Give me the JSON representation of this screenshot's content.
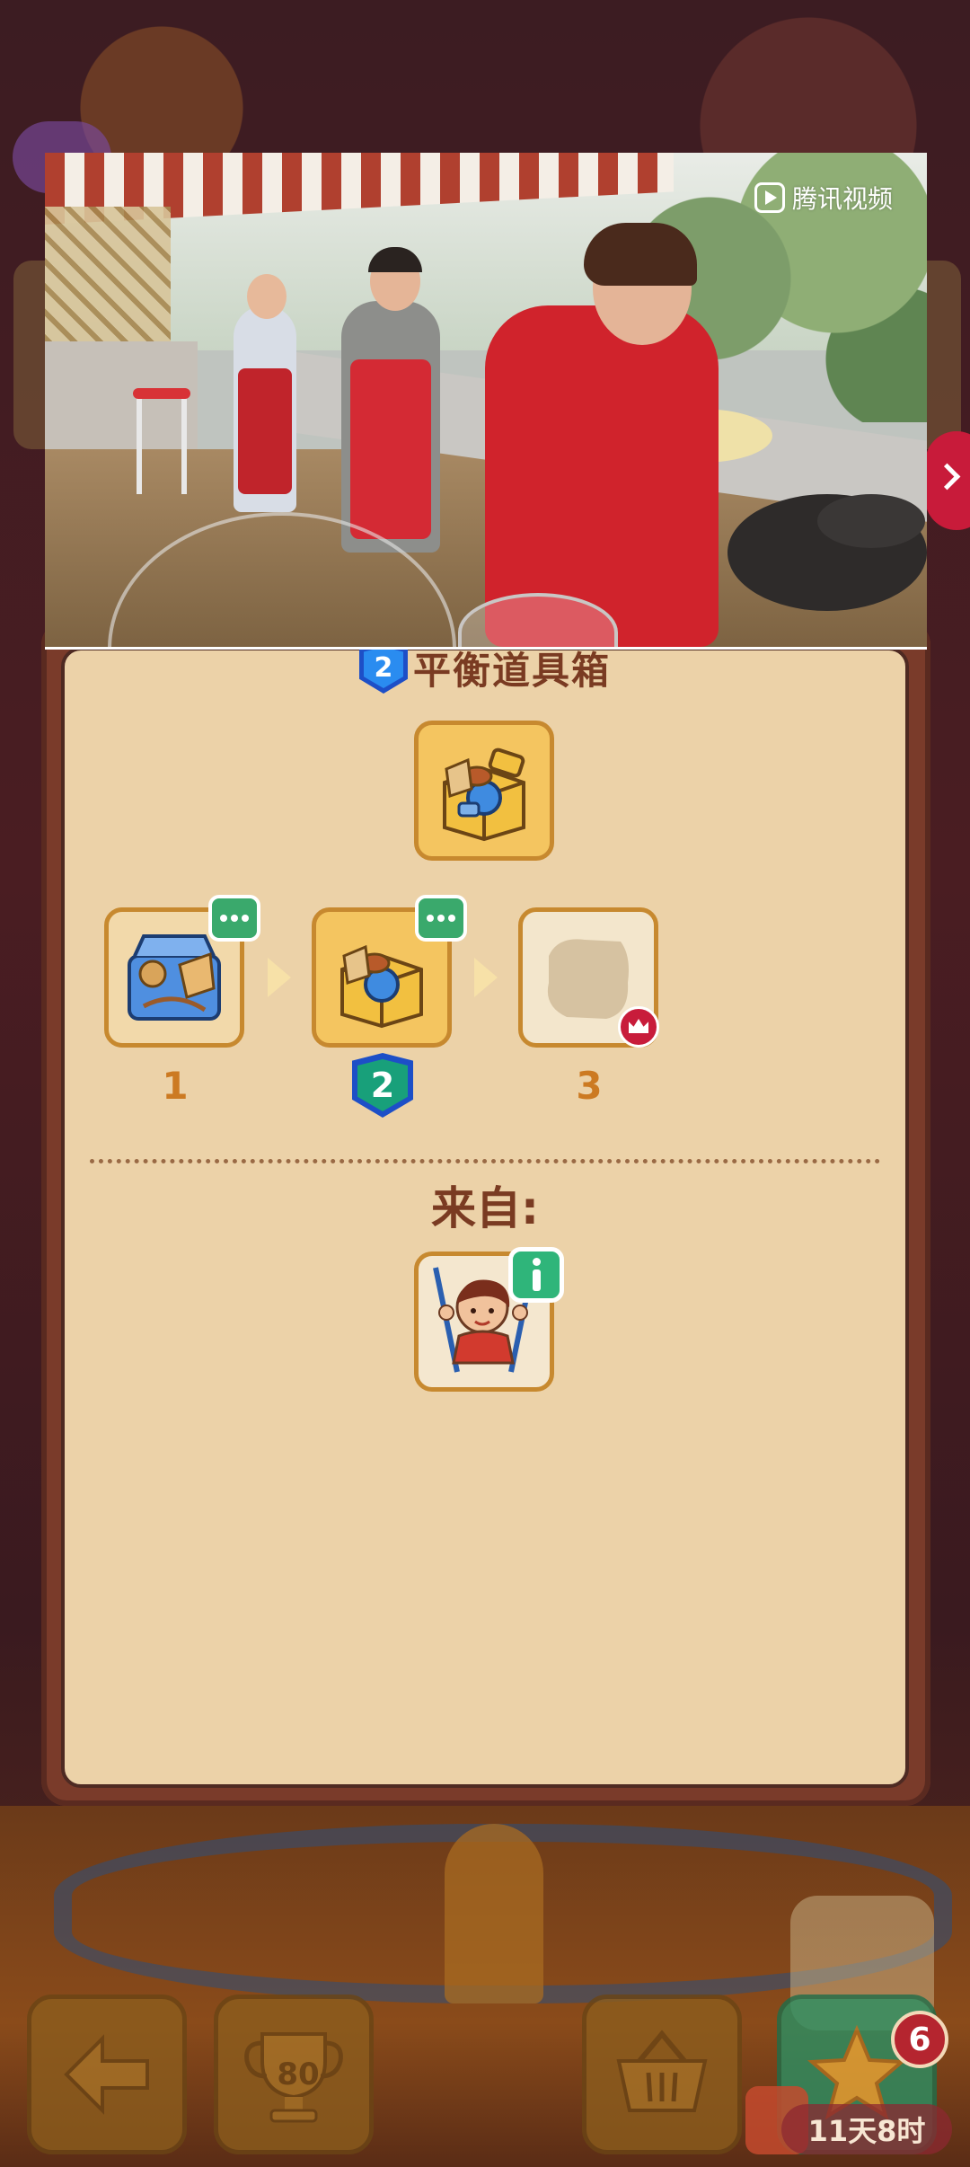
{
  "video": {
    "logo_text": "腾讯视频"
  },
  "panel": {
    "title": "平衡道具箱",
    "title_level": "2",
    "main_item_icon": "toolbox-gold-icon",
    "chain": [
      {
        "level_label": "1",
        "icon": "toolbox-blue-icon"
      },
      {
        "level_label": "2",
        "icon": "toolbox-gold-icon"
      },
      {
        "level_label": "3",
        "icon": "locked-silhouette-icon"
      }
    ],
    "from_label": "来自:",
    "source_icon": "acrobat-girl-icon"
  },
  "bottom_bar": {
    "trophy_count": "80",
    "star_badge_count": "6",
    "event_timer": "11天8时"
  },
  "colors": {
    "panel_bg": "#ecd2a8",
    "panel_frame": "#7a3b2a",
    "title_text": "#7a3b22",
    "level_number": "#cc7a22",
    "badge_green": "#3aa96c",
    "shield_blue": "#1d4fc7"
  }
}
